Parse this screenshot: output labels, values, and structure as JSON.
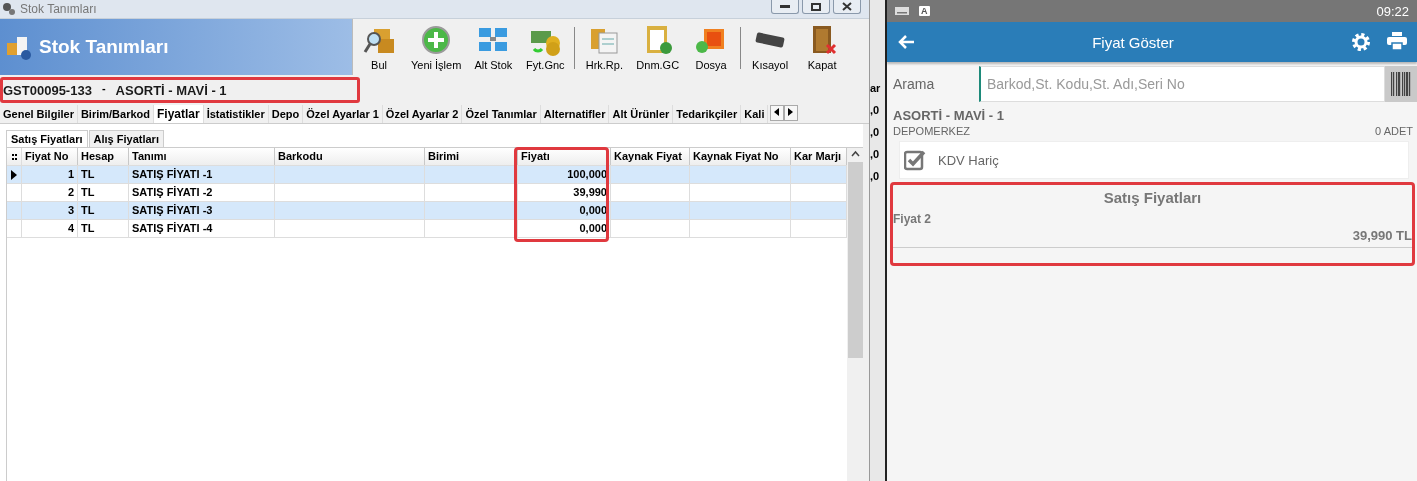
{
  "window": {
    "title": "Stok Tanımları"
  },
  "header": {
    "title": "Stok Tanımları"
  },
  "toolbar": {
    "groups": [
      [
        "Bul",
        "Yeni İşlem",
        "Alt Stok",
        "Fyt.Gnc"
      ],
      [
        "Hrk.Rp.",
        "Dnm.GC",
        "Dosya"
      ],
      [
        "Kısayol",
        "Kapat"
      ]
    ]
  },
  "record": {
    "code": "GST00095-133",
    "separator": "-",
    "name": "ASORTİ - MAVİ - 1"
  },
  "tabs": [
    {
      "label": "Genel Bilgiler",
      "selected": false
    },
    {
      "label": "Birim/Barkod",
      "selected": false
    },
    {
      "label": "Fiyatlar",
      "selected": true
    },
    {
      "label": "İstatistikler",
      "selected": false
    },
    {
      "label": "Depo",
      "selected": false
    },
    {
      "label": "Özel Ayarlar 1",
      "selected": false
    },
    {
      "label": "Özel Ayarlar 2",
      "selected": false
    },
    {
      "label": "Özel Tanımlar",
      "selected": false
    },
    {
      "label": "Alternatifler",
      "selected": false
    },
    {
      "label": "Alt Ürünler",
      "selected": false
    },
    {
      "label": "Tedarikçiler",
      "selected": false
    },
    {
      "label": "Kali",
      "selected": false
    }
  ],
  "subtabs": [
    {
      "label": "Satış Fiyatları",
      "selected": true
    },
    {
      "label": "Alış Fiyatları",
      "selected": false
    }
  ],
  "table": {
    "columns": [
      "Fiyat No",
      "Hesap",
      "Tanımı",
      "Barkodu",
      "Birimi",
      "Fiyatı",
      "Kaynak Fiyat",
      "Kaynak Fiyat No",
      "Kar Marjı"
    ],
    "rows": [
      {
        "current": true,
        "cells": [
          "1",
          "TL",
          "SATIŞ FİYATI -1",
          "",
          "",
          "100,000",
          "",
          "",
          ""
        ]
      },
      {
        "current": false,
        "cells": [
          "2",
          "TL",
          "SATIŞ FİYATI -2",
          "",
          "",
          "39,990",
          "",
          "",
          ""
        ]
      },
      {
        "current": false,
        "cells": [
          "3",
          "TL",
          "SATIŞ FİYATI -3",
          "",
          "",
          "0,000",
          "",
          "",
          ""
        ]
      },
      {
        "current": false,
        "cells": [
          "4",
          "TL",
          "SATIŞ FİYATI -4",
          "",
          "",
          "0,000",
          "",
          "",
          ""
        ]
      }
    ]
  },
  "background_window": {
    "fragments": [
      "ar",
      ",0",
      ",0",
      ",0",
      ",0"
    ]
  },
  "phone": {
    "status_bar": {
      "time": "09:22",
      "input_badge": "A"
    },
    "app_bar": {
      "title": "Fiyat Göster"
    },
    "search": {
      "label": "Arama",
      "placeholder": "Barkod,St. Kodu,St. Adı,Seri No"
    },
    "product": {
      "name": "ASORTİ - MAVİ - 1",
      "warehouse": "DEPOMERKEZ",
      "quantity": "0 ADET"
    },
    "vat_option": {
      "label": "KDV Hariç",
      "checked": true
    },
    "prices": {
      "title": "Satış Fiyatları",
      "items": [
        {
          "label": "Fiyat 2",
          "value": "39,990 TL"
        }
      ]
    }
  }
}
